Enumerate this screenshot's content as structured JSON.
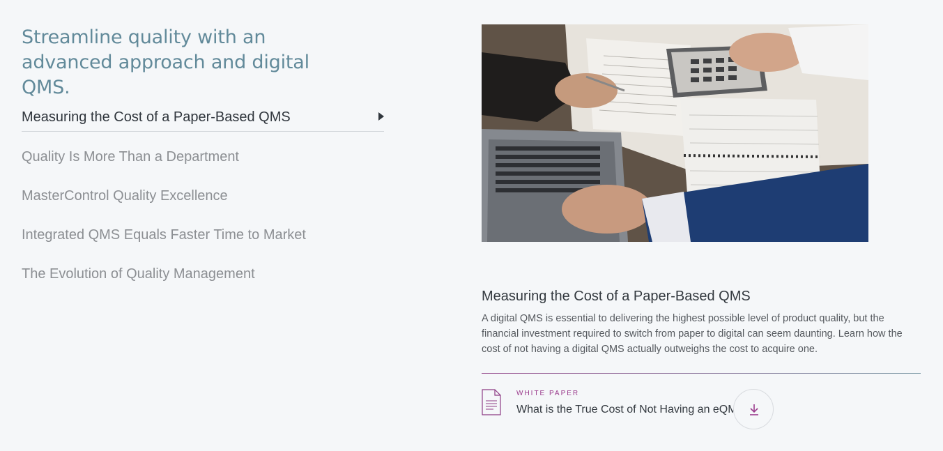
{
  "section": {
    "headline": "Streamline quality with an advanced approach and digital QMS."
  },
  "topics": [
    {
      "label": "Measuring the Cost of a Paper-Based QMS",
      "active": true
    },
    {
      "label": "Quality Is More Than a Department",
      "active": false
    },
    {
      "label": "MasterControl Quality Excellence",
      "active": false
    },
    {
      "label": "Integrated QMS Equals Faster Time to Market",
      "active": false
    },
    {
      "label": "The Evolution of Quality Management",
      "active": false
    }
  ],
  "detail": {
    "title": "Measuring the Cost of a Paper-Based QMS",
    "description": "A digital QMS is essential to delivering the highest possible level of product quality, but the financial investment required to switch from paper to digital can seem daunting. Learn how the cost of not having a digital QMS actually outweighs the cost to acquire one.",
    "resource": {
      "type": "WHITE PAPER",
      "title": "What is the True Cost of Not Having an eQMS?",
      "icon": "document-icon",
      "action_icon": "download-icon"
    }
  },
  "colors": {
    "background": "#f5f7f9",
    "headline": "#628a9a",
    "accent": "#9a3a8c",
    "active_text": "#30363d",
    "inactive_text": "#8c8f93"
  }
}
